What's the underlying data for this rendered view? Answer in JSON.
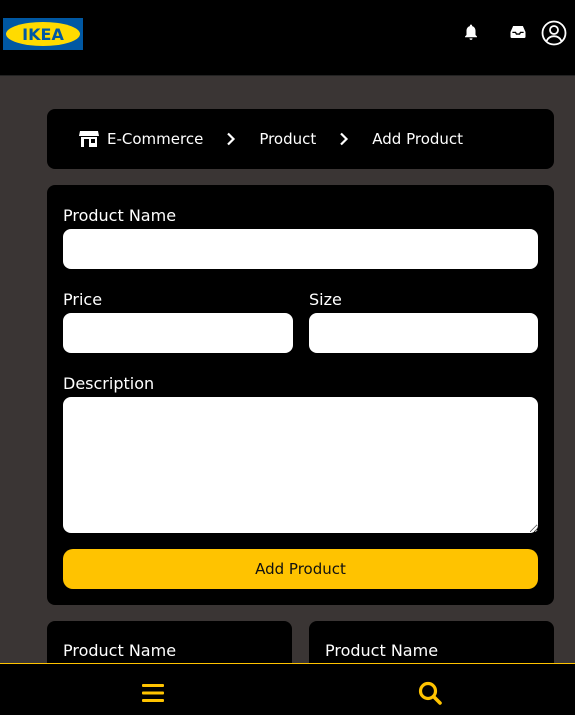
{
  "header": {
    "logo_text": "IKEA",
    "icons": [
      "bell-icon",
      "inbox-icon",
      "user-circle-icon"
    ]
  },
  "breadcrumb": {
    "icon": "store-icon",
    "items": [
      "E-Commerce",
      "Product",
      "Add Product"
    ]
  },
  "form": {
    "product_name_label": "Product Name",
    "price_label": "Price",
    "size_label": "Size",
    "description_label": "Description",
    "product_name_value": "",
    "price_value": "",
    "size_value": "",
    "description_value": "",
    "submit_label": "Add Product"
  },
  "product_cards": [
    {
      "title": "Product Name"
    },
    {
      "title": "Product Name"
    }
  ],
  "bottom_nav": {
    "icons": [
      "menu-icon",
      "search-icon"
    ]
  },
  "colors": {
    "accent": "#ffc300",
    "background": "#3a3534",
    "panel": "#000000",
    "logo_blue": "#0058a3",
    "logo_yellow": "#ffdb00"
  }
}
